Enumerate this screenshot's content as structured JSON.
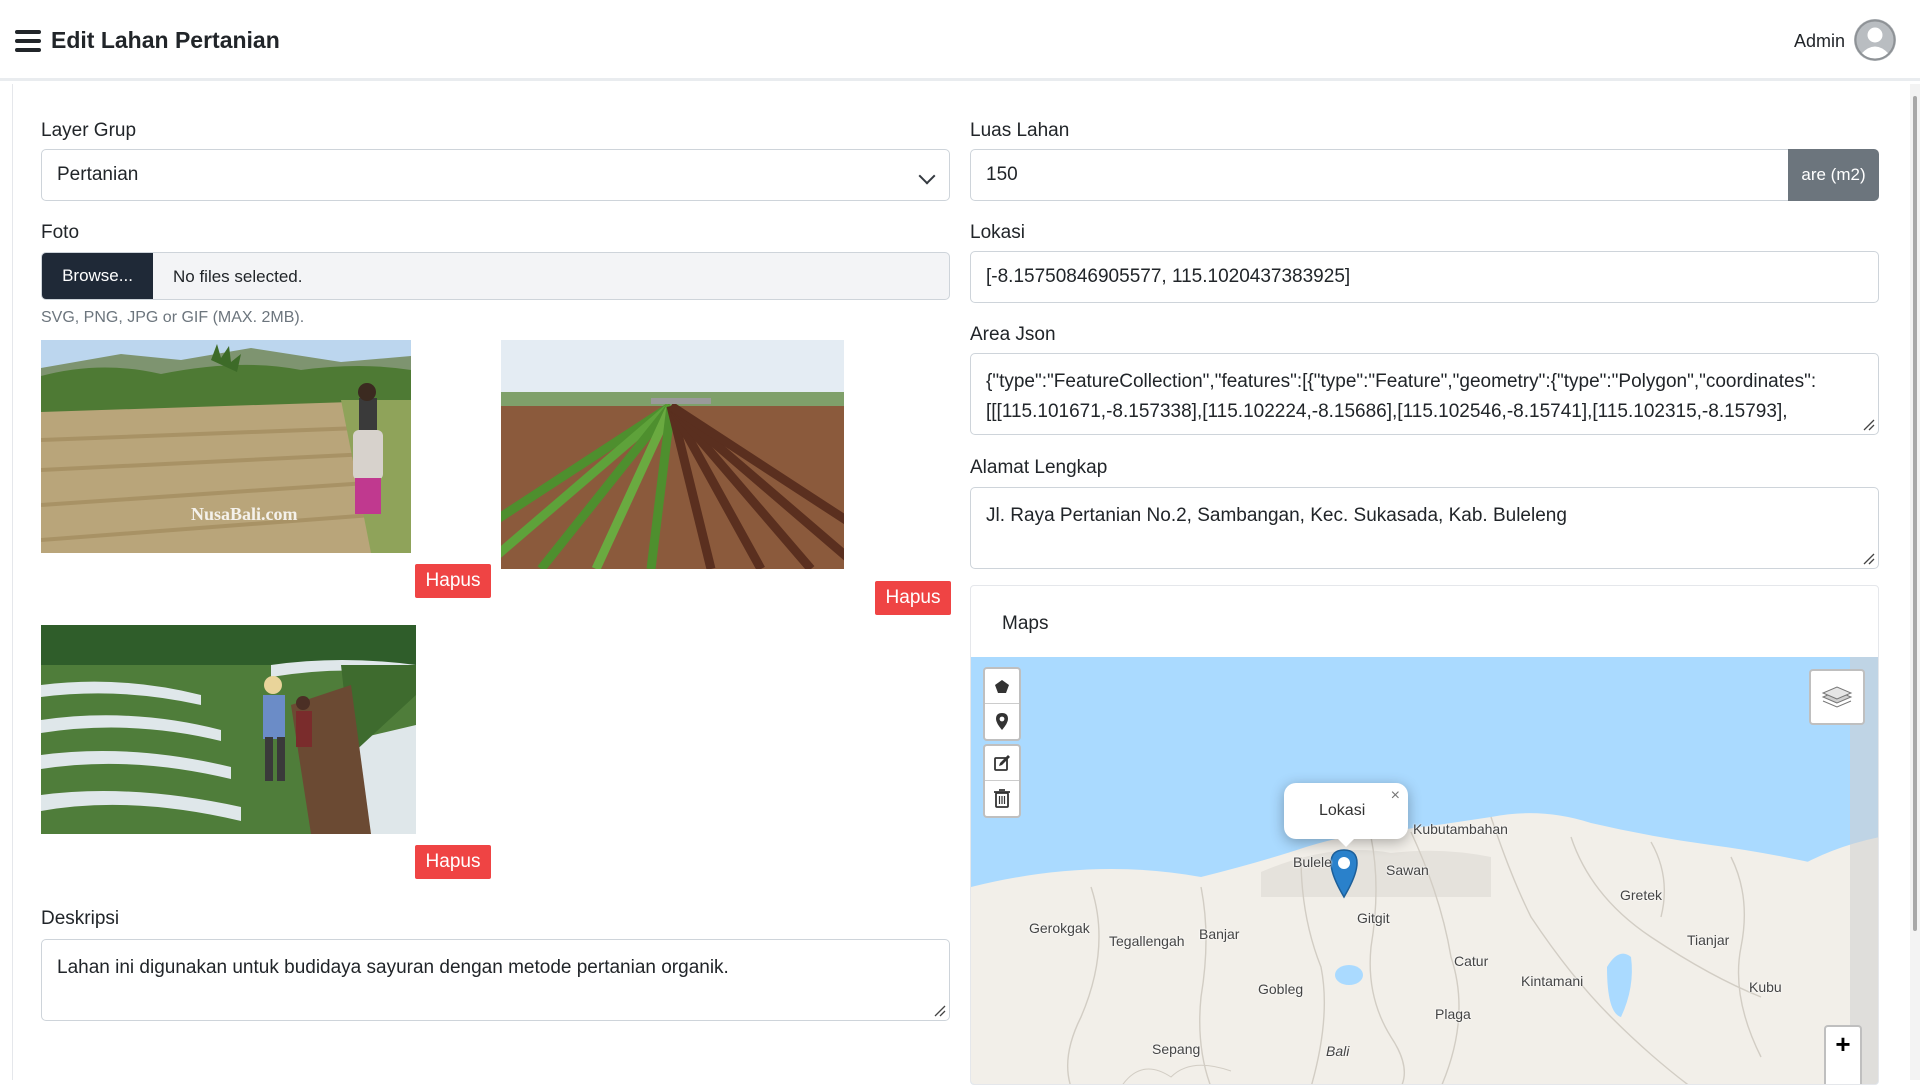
{
  "header": {
    "title": "Edit Lahan Pertanian",
    "user_name": "Admin"
  },
  "form": {
    "layer_grup": {
      "label": "Layer Grup",
      "value": "Pertanian"
    },
    "foto": {
      "label": "Foto",
      "browse_label": "Browse...",
      "file_status": "No files selected.",
      "hint": "SVG, PNG, JPG or GIF (MAX. 2MB).",
      "photos": [
        {
          "watermark": "NusaBali.com",
          "delete_label": "Hapus"
        },
        {
          "delete_label": "Hapus"
        },
        {
          "delete_label": "Hapus"
        }
      ]
    },
    "deskripsi": {
      "label": "Deskripsi",
      "value": "Lahan ini digunakan untuk budidaya sayuran dengan metode pertanian organik."
    },
    "luas_lahan": {
      "label": "Luas Lahan",
      "value": "150",
      "unit": "are (m2)"
    },
    "lokasi": {
      "label": "Lokasi",
      "value": "[-8.15750846905577, 115.1020437383925]"
    },
    "area_json": {
      "label": "Area Json",
      "line1": "{\"type\":\"FeatureCollection\",\"features\":[{\"type\":\"Feature\",\"geometry\":{\"type\":\"Polygon\",\"coordinates\":",
      "line2": "[[[115.101671,-8.157338],[115.102224,-8.15686],[115.102546,-8.15741],[115.102315,-8.15793],"
    },
    "alamat_lengkap": {
      "label": "Alamat Lengkap",
      "value": "Jl. Raya Pertanian No.2, Sambangan, Kec. Sukasada, Kab. Buleleng"
    }
  },
  "maps": {
    "title": "Maps",
    "popup_text": "Lokasi",
    "popup_close": "×",
    "zoom_in": "+",
    "places": {
      "kubutambahan": "Kubutambahan",
      "buleleng": "Bulele",
      "sawan": "Sawan",
      "gretek": "Gretek",
      "gerokgak": "Gerokgak",
      "tegallengah": "Tegallengah",
      "banjar": "Banjar",
      "gitgit": "Gitgit",
      "tianjar": "Tianjar",
      "catur": "Catur",
      "kintamani": "Kintamani",
      "kubu": "Kubu",
      "gobleg": "Gobleg",
      "plaga": "Plaga",
      "sepang": "Sepang",
      "bali": "Bali"
    }
  },
  "colors": {
    "danger": "#ef4444",
    "dark_button": "#1f2937",
    "addon": "#6c757d",
    "sea": "#aadaff",
    "land": "#f2efe9"
  }
}
